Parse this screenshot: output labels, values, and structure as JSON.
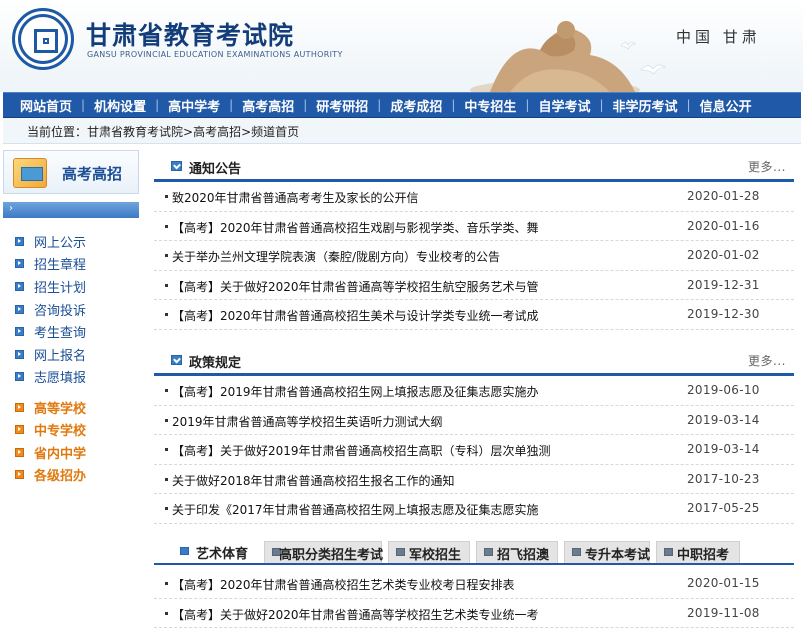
{
  "header": {
    "title": "甘肃省教育考试院",
    "subtitle": "GANSU PROVINCIAL EDUCATION EXAMINATIONS AUTHORITY",
    "region": "中国 甘肃",
    "colors": {
      "brand_blue": "#1f59a8",
      "accent_orange": "#e07a10"
    }
  },
  "nav": {
    "items": [
      "网站首页",
      "机构设置",
      "高中学考",
      "高考高招",
      "研考研招",
      "成考成招",
      "中专招生",
      "自学考试",
      "非学历考试",
      "信息公开"
    ]
  },
  "breadcrumb": {
    "prefix": "当前位置：",
    "path": "甘肃省教育考试院>高考高招>频道首页"
  },
  "sidebar": {
    "title": "高考高招",
    "bar_glyph": "›",
    "items": [
      "网上公示",
      "招生章程",
      "招生计划",
      "咨询投诉",
      "考生查询",
      "网上报名",
      "志愿填报"
    ],
    "sub_items": [
      "高等学校",
      "中专学校",
      "省内中学",
      "各级招办"
    ]
  },
  "sections": {
    "notice": {
      "title": "通知公告",
      "more": "更多...",
      "rows": [
        {
          "title": "致2020年甘肃省普通高考考生及家长的公开信",
          "date": "2020-01-28"
        },
        {
          "title": "【高考】2020年甘肃省普通高校招生戏剧与影视学类、音乐学类、舞",
          "date": "2020-01-16"
        },
        {
          "title": "关于举办兰州文理学院表演（秦腔/陇剧方向）专业校考的公告",
          "date": "2020-01-02"
        },
        {
          "title": "【高考】关于做好2020年甘肃省普通高等学校招生航空服务艺术与管",
          "date": "2019-12-31"
        },
        {
          "title": "【高考】2020年甘肃省普通高校招生美术与设计学类专业统一考试成",
          "date": "2019-12-30"
        }
      ]
    },
    "policy": {
      "title": "政策规定",
      "more": "更多...",
      "rows": [
        {
          "title": "【高考】2019年甘肃省普通高校招生网上填报志愿及征集志愿实施办",
          "date": "2019-06-10"
        },
        {
          "title": "2019年甘肃省普通高等学校招生英语听力测试大纲",
          "date": "2019-03-14"
        },
        {
          "title": "【高考】关于做好2019年甘肃省普通高校招生高职（专科）层次单独测",
          "date": "2019-03-14"
        },
        {
          "title": "关于做好2018年甘肃省普通高校招生报名工作的通知",
          "date": "2017-10-23"
        },
        {
          "title": "关于印发《2017年甘肃省普通高校招生网上填报志愿及征集志愿实施",
          "date": "2017-05-25"
        }
      ]
    },
    "tabs": {
      "items": [
        "艺术体育",
        "高职分类招生考试",
        "军校招生",
        "招飞招澳",
        "专升本考试",
        "中职招考"
      ],
      "rows": [
        {
          "title": "【高考】2020年甘肃省普通高校招生艺术类专业校考日程安排表",
          "date": "2020-01-15"
        },
        {
          "title": "【高考】关于做好2020年甘肃省普通高等学校招生艺术类专业统一考",
          "date": "2019-11-08"
        }
      ]
    }
  }
}
